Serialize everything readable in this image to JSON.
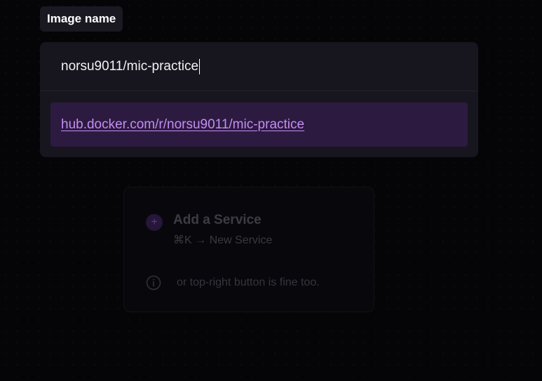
{
  "field": {
    "label": "Image name"
  },
  "image_input": {
    "value": "norsu9011/mic-practice"
  },
  "suggestion": {
    "link_text": "hub.docker.com/r/norsu9011/mic-practice"
  },
  "hint": {
    "plus_icon": "+",
    "title": "Add a Service",
    "shortcut": "⌘K → New Service",
    "note": "or top-right button is fine too."
  },
  "icons": {
    "plus": "plus-circle-icon",
    "info": "info-circle-icon"
  },
  "colors": {
    "background": "#050407",
    "panel": "#17161f",
    "suggestion_bg": "#2d1a41",
    "link": "#c38ef0"
  }
}
